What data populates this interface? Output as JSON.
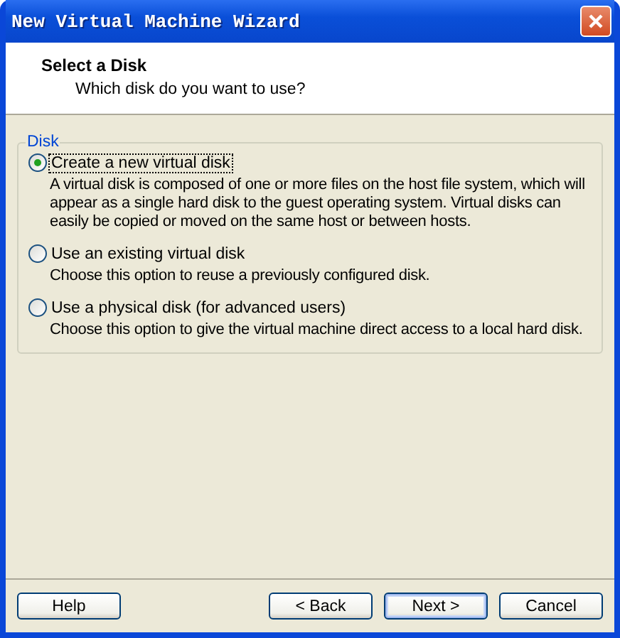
{
  "window": {
    "title": "New Virtual Machine Wizard"
  },
  "header": {
    "title": "Select a Disk",
    "subtitle": "Which disk do you want to use?"
  },
  "group": {
    "label": "Disk",
    "options": [
      {
        "label": "Create a new virtual disk",
        "description": "A virtual disk is composed of one or more files on the host file system, which will appear as a single hard disk to the guest operating system. Virtual disks can easily be copied or moved on the same host or between hosts.",
        "selected": true,
        "focused": true
      },
      {
        "label": "Use an existing virtual disk",
        "description": "Choose this option to reuse a previously configured disk.",
        "selected": false,
        "focused": false
      },
      {
        "label": "Use a physical disk (for advanced users)",
        "description": "Choose this option to give the virtual machine direct access to a local hard disk.",
        "selected": false,
        "focused": false
      }
    ]
  },
  "buttons": [
    {
      "label": "Help",
      "default": false
    },
    {
      "label": "< Back",
      "default": false
    },
    {
      "label": "Next >",
      "default": true
    },
    {
      "label": "Cancel",
      "default": false
    }
  ]
}
